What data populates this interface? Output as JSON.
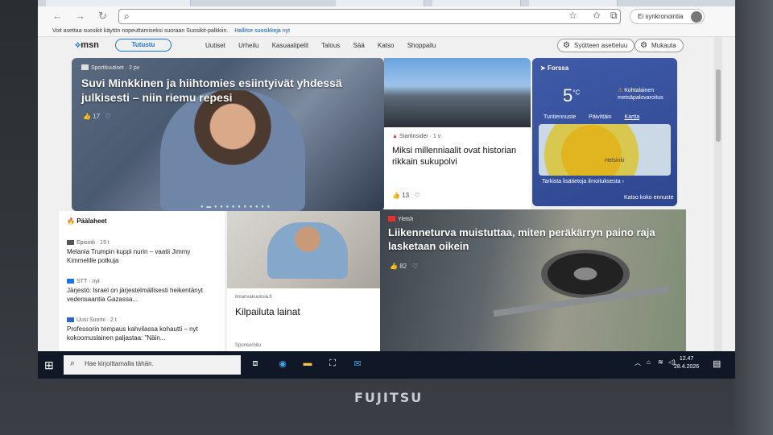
{
  "browser": {
    "sync_label": "Ei synkronointia",
    "favorites_notice": "Voit asettaa suosikit käytön nopeuttamiseksi suoraan Suosikit-palkkiin.",
    "favorites_link": "Hallitse suosikkeja nyt"
  },
  "header": {
    "logo": "msn",
    "tutustu": "Tutustu",
    "nav": [
      "Uutiset",
      "Urheilu",
      "Kasuaalipelit",
      "Talous",
      "Sää",
      "Katso",
      "Shoppailu"
    ],
    "feed_settings": "Syötteen asetteluu",
    "customize": "Mukauta"
  },
  "hero": {
    "source": "Sporttiuutiset · 2 pv",
    "title": "Suvi Minkkinen ja hiihtomies esiintyivät yhdessä julkisesti – niin riemu repesi",
    "likes": "17"
  },
  "millennials": {
    "source": "StartInsider · 1 v",
    "title": "Miksi millenniaalit ovat historian rikkain sukupolvi",
    "likes": "13"
  },
  "weather": {
    "location": "Forssa",
    "temp": "5",
    "unit": "°C",
    "warning": "Kohtalainen metsäpalovaroitus",
    "tabs": [
      "Tuntiennuste",
      "Päivittäin",
      "Kartta"
    ],
    "map_city": "Helsinki",
    "note": "Tarkista lisätietoja ilmoituksesta",
    "footer": "Katso koko ennuste"
  },
  "top_news": {
    "title": "Päälaheet",
    "items": [
      {
        "source": "Episodi · 15 t",
        "title": "Melania Trumpin kuppi nurin – vaatii Jimmy Kimmelille potkuja"
      },
      {
        "source": "STT · nyt",
        "title": "Järjestö: Israel on järjestelmällisesti heikentänyt vedensaantia Gazassa..."
      },
      {
        "source": "Uusi Suomi · 2 t",
        "title": "Professorin tempaus kahvilassa kohautti – nyt kokoomuslainen paljastaa: \"Näin..."
      }
    ]
  },
  "ad": {
    "source": "ilmarivakuuksia.fi",
    "title": "Kilpailuta lainat",
    "sponsored": "Sponsoroitu"
  },
  "trailer": {
    "source": "Yletsh",
    "title": "Liikenneturva muistuttaa, miten peräkärryn paino raja lasketaan oikein",
    "likes": "82"
  },
  "taskbar": {
    "search_placeholder": "Hae kirjoittamalla tähän.",
    "time": "12.47",
    "date": "28.4.2026"
  },
  "laptop": {
    "brand": "FUJITSU"
  }
}
